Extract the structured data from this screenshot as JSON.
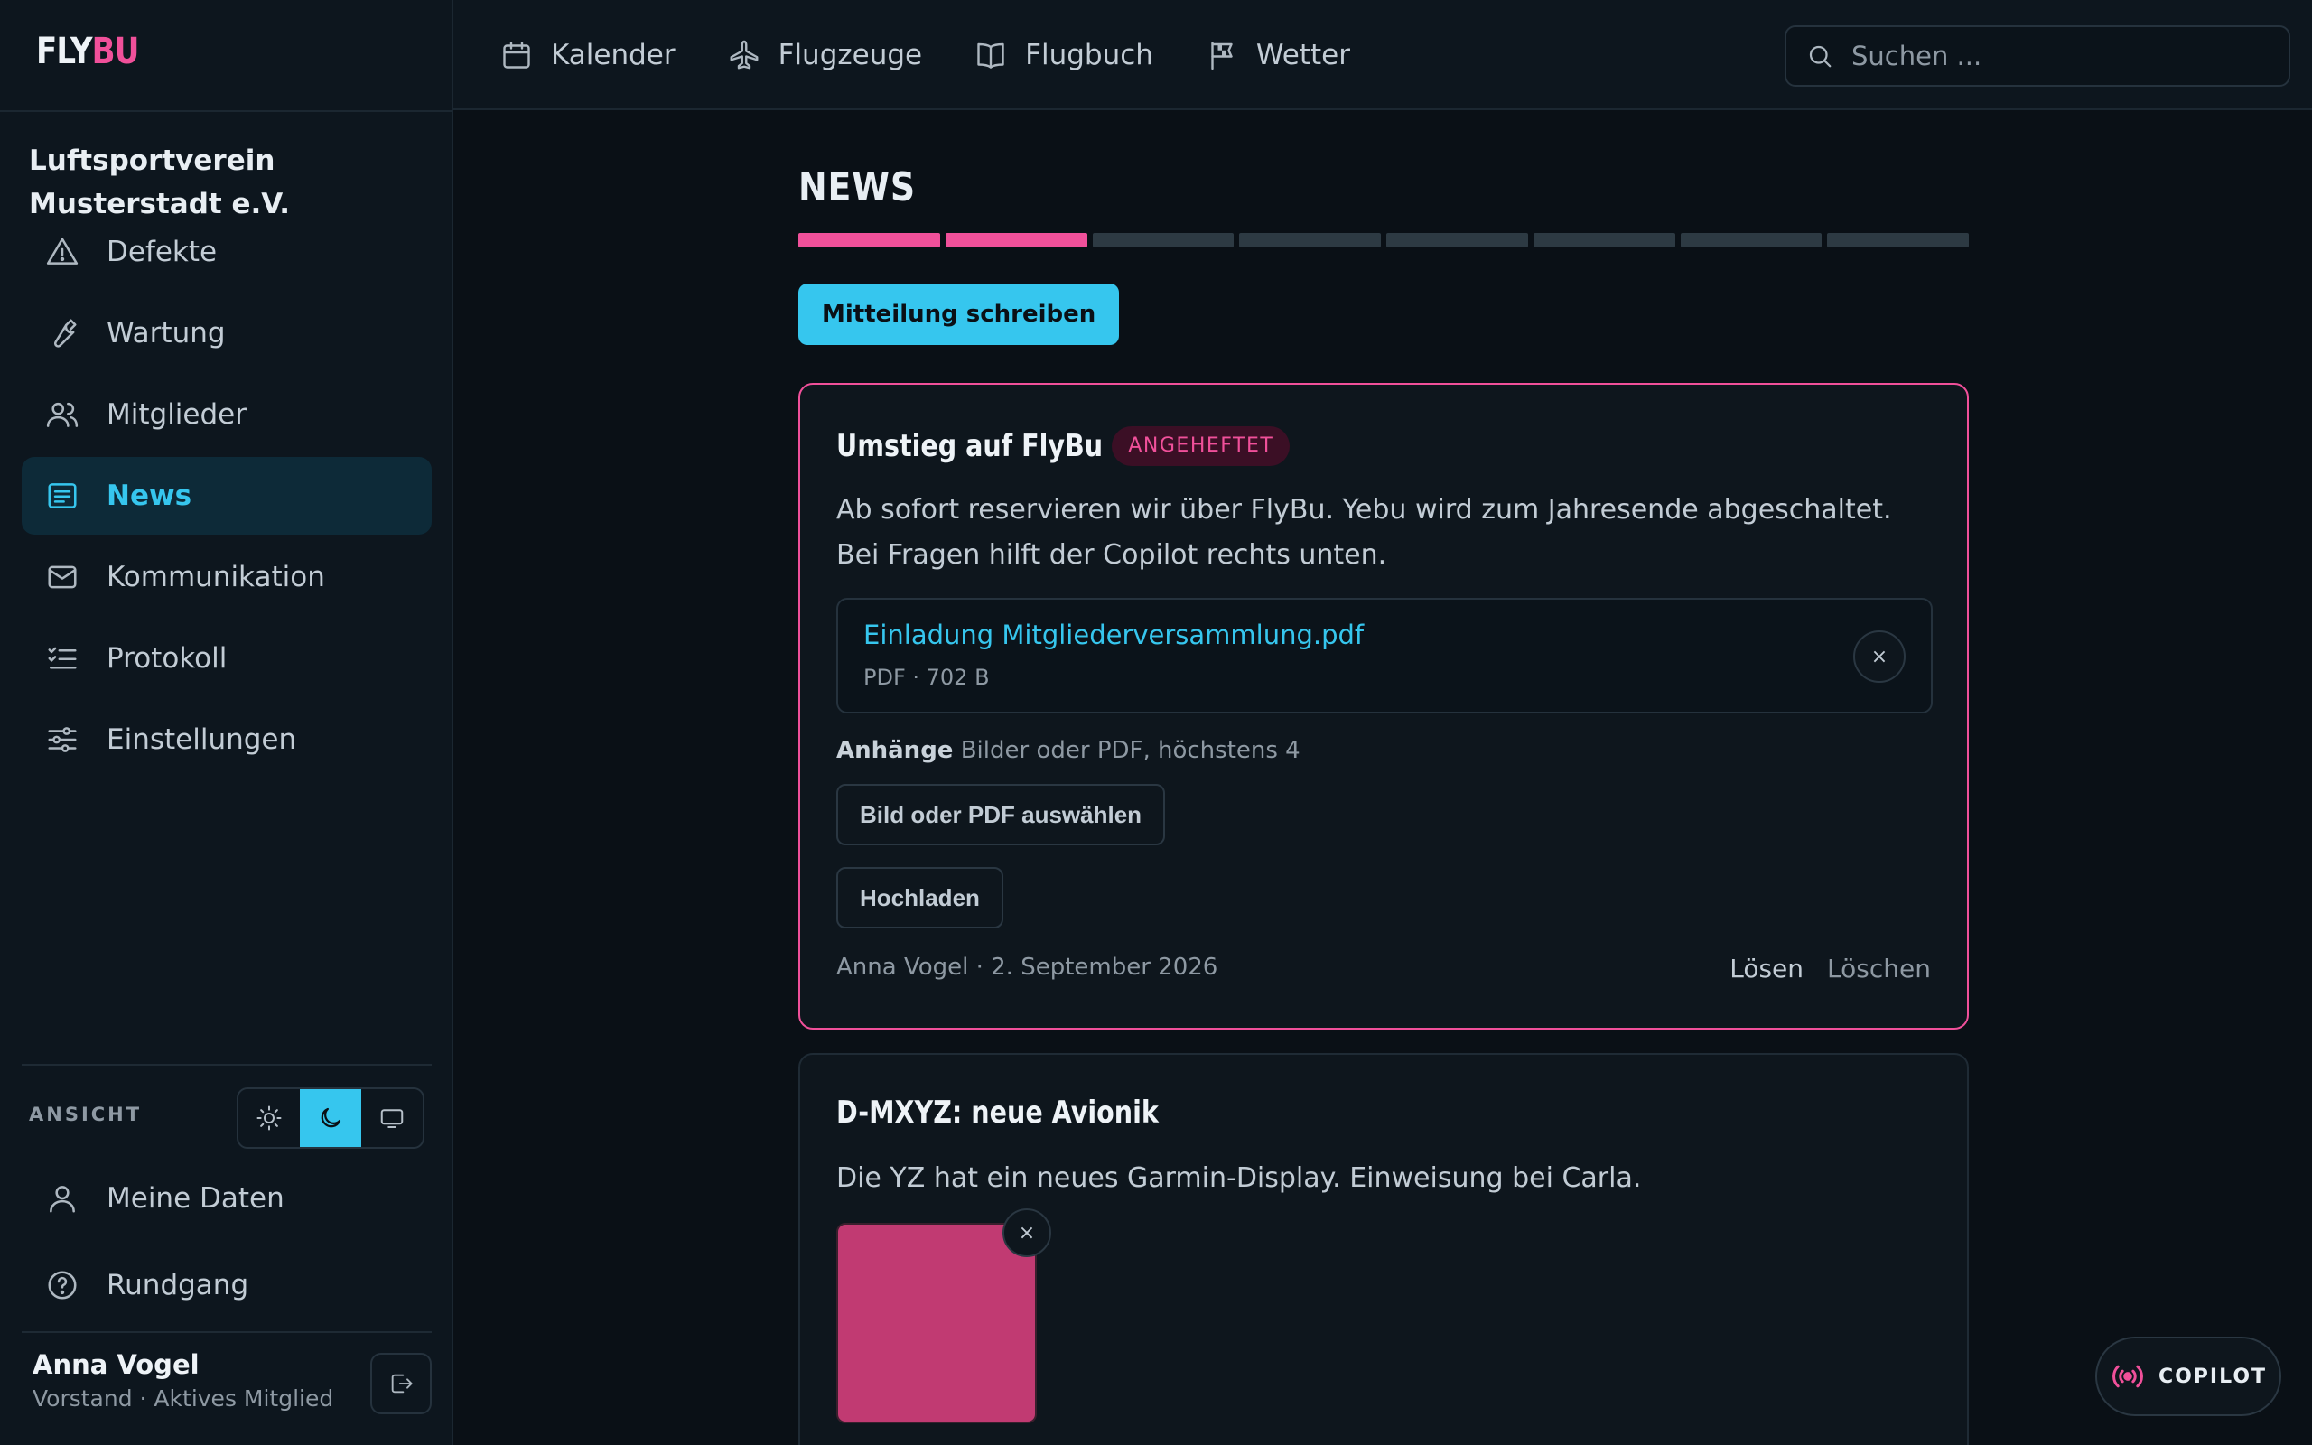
{
  "app": {
    "logo_part1": "FLY",
    "logo_part2": "BU"
  },
  "club": {
    "name": "Luftsportverein Musterstadt e.V."
  },
  "sidebar": {
    "items": [
      {
        "label": "Defekte",
        "icon": "warning-icon"
      },
      {
        "label": "Wartung",
        "icon": "wrench-icon"
      },
      {
        "label": "Mitglieder",
        "icon": "users-icon"
      },
      {
        "label": "News",
        "icon": "newspaper-icon",
        "active": true
      },
      {
        "label": "Kommunikation",
        "icon": "mail-icon"
      },
      {
        "label": "Protokoll",
        "icon": "list-check-icon"
      },
      {
        "label": "Einstellungen",
        "icon": "sliders-icon"
      }
    ],
    "view_label": "ANSICHT",
    "theme_selected": "dark",
    "bottom_items": [
      {
        "label": "Meine Daten",
        "icon": "user-icon"
      },
      {
        "label": "Rundgang",
        "icon": "help-circle-icon"
      }
    ],
    "user": {
      "name": "Anna Vogel",
      "role": "Vorstand · Aktives Mitglied"
    }
  },
  "topnav": {
    "items": [
      {
        "label": "Kalender",
        "icon": "calendar-icon"
      },
      {
        "label": "Flugzeuge",
        "icon": "plane-icon"
      },
      {
        "label": "Flugbuch",
        "icon": "book-icon"
      },
      {
        "label": "Wetter",
        "icon": "flag-icon"
      }
    ],
    "search_placeholder": "Suchen ..."
  },
  "main": {
    "title": "NEWS",
    "progress": {
      "total": 8,
      "done": 2
    },
    "write_button": "Mitteilung schreiben",
    "posts": [
      {
        "title": "Umstieg auf FlyBu",
        "badge": "ANGEHEFTET",
        "body": "Ab sofort reservieren wir über FlyBu. Yebu wird zum Jahresende abgeschaltet. Bei Fragen hilft der Copilot rechts unten.",
        "attachment": {
          "name": "Einladung Mitgliederversammlung.pdf",
          "meta": "PDF · 702 B"
        },
        "attachments_label": "Anhänge",
        "attachments_hint": "Bilder oder PDF, höchstens 4",
        "choose_button": "Bild oder PDF auswählen",
        "upload_button": "Hochladen",
        "footer": "Anna Vogel · 2. September 2026",
        "action_release": "Lösen",
        "action_delete": "Löschen"
      },
      {
        "title": "D-MXYZ: neue Avionik",
        "body": "Die YZ hat ein neues Garmin-Display. Einweisung bei Carla.",
        "image_color": "#c13a72"
      }
    ]
  },
  "copilot": {
    "label": "COPILOT"
  },
  "colors": {
    "accent": "#36c6ee",
    "brand": "#f0509a",
    "background": "#0a1016"
  },
  "remove_glyph": "×"
}
